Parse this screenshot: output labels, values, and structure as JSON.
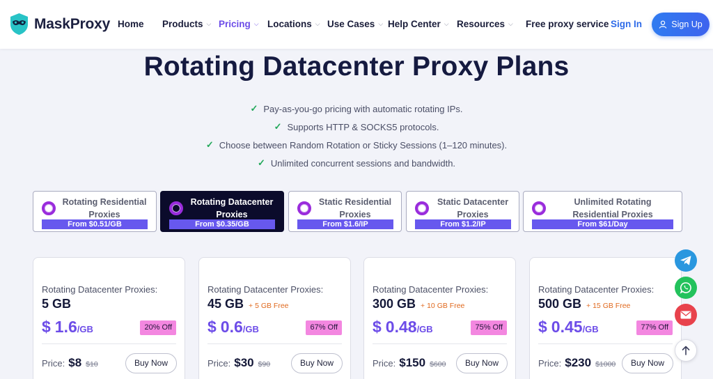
{
  "header": {
    "logo_text": "MaskProxy",
    "nav": [
      {
        "label": "Home",
        "dropdown": false,
        "active": false
      },
      {
        "label": "Products",
        "dropdown": true,
        "active": false
      },
      {
        "label": "Pricing",
        "dropdown": true,
        "active": true
      },
      {
        "label": "Locations",
        "dropdown": true,
        "active": false
      },
      {
        "label": "Use Cases",
        "dropdown": true,
        "active": false
      },
      {
        "label": "Help Center",
        "dropdown": true,
        "active": false
      },
      {
        "label": "Resources",
        "dropdown": true,
        "active": false
      },
      {
        "label": "Free proxy service",
        "dropdown": false,
        "active": false
      }
    ],
    "signin_label": "Sign In",
    "signup_label": "Sign Up"
  },
  "hero": {
    "title": "Rotating Datacenter Proxy Plans",
    "features": [
      "Pay-as-you-go pricing with automatic rotating IPs.",
      "Supports HTTP & SOCKS5 protocols.",
      "Choose between Random Rotation or Sticky Sessions (1–120 minutes).",
      "Unlimited concurrent sessions and bandwidth."
    ]
  },
  "plan_tabs": [
    {
      "line1": "Rotating Residential",
      "line2": "Proxies",
      "price": "From $0.51/GB",
      "active": false
    },
    {
      "line1": "Rotating Datacenter",
      "line2": "Proxies",
      "price": "From $0.35/GB",
      "active": true
    },
    {
      "line1": "Static Residential",
      "line2": "Proxies",
      "price": "From $1.6/IP",
      "active": false
    },
    {
      "line1": "Static Datacenter",
      "line2": "Proxies",
      "price": "From $1.2/IP",
      "active": false
    },
    {
      "line1": "Unlimited Rotating",
      "line2": "Residential Proxies",
      "price": "From $61/Day",
      "active": false
    }
  ],
  "products": [
    {
      "type": "Rotating Datacenter Proxies:",
      "size": "5 GB",
      "bonus": "",
      "currency": "$",
      "price_per_gb": "1.6",
      "unit": "/GB",
      "discount": "20% Off",
      "price_label": "Price:",
      "total": "$8",
      "original": "$10",
      "button": "Buy Now"
    },
    {
      "type": "Rotating Datacenter Proxies:",
      "size": "45 GB",
      "bonus": "+ 5 GB Free",
      "currency": "$",
      "price_per_gb": "0.6",
      "unit": "/GB",
      "discount": "67% Off",
      "price_label": "Price:",
      "total": "$30",
      "original": "$90",
      "button": "Buy Now"
    },
    {
      "type": "Rotating Datacenter Proxies:",
      "size": "300 GB",
      "bonus": "+ 10 GB Free",
      "currency": "$",
      "price_per_gb": "0.48",
      "unit": "/GB",
      "discount": "75% Off",
      "price_label": "Price:",
      "total": "$150",
      "original": "$600",
      "button": "Buy Now"
    },
    {
      "type": "Rotating Datacenter Proxies:",
      "size": "500 GB",
      "bonus": "+ 15 GB Free",
      "currency": "$",
      "price_per_gb": "0.45",
      "unit": "/GB",
      "discount": "77% Off",
      "price_label": "Price:",
      "total": "$230",
      "original": "$1000",
      "button": "Buy Now"
    }
  ],
  "floating": [
    "telegram-icon",
    "whatsapp-icon",
    "email-icon",
    "arrow-up-icon"
  ],
  "colors": {
    "accent": "#6c4ce8",
    "link": "#2f6be8",
    "discount_badge": "#f387e0",
    "bonus": "#e0691e"
  }
}
